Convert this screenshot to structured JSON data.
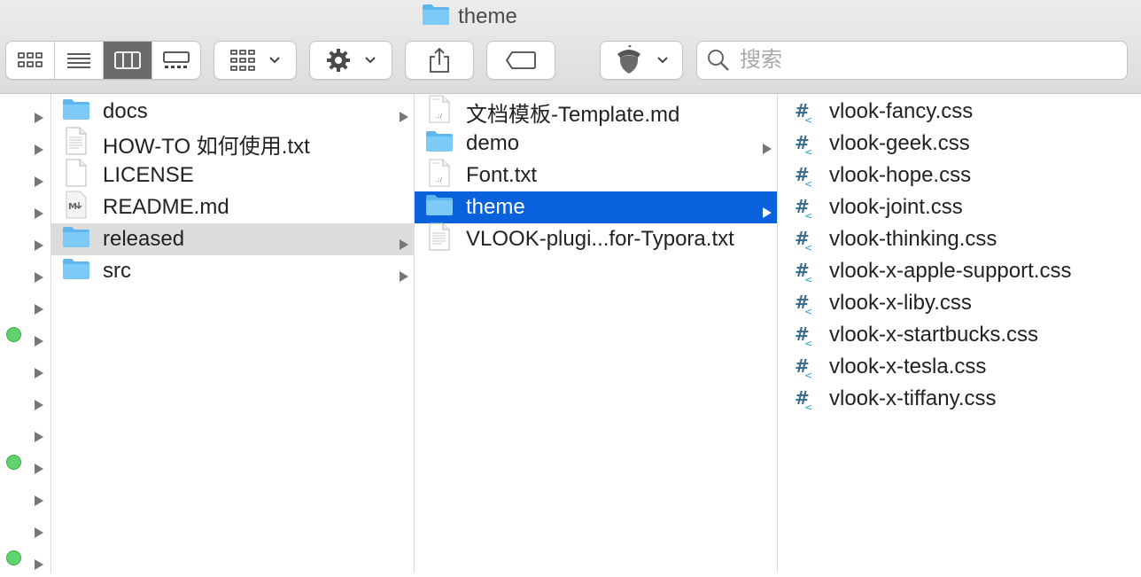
{
  "window": {
    "title": "theme",
    "title_icon": "folder-icon"
  },
  "toolbar": {
    "view_modes": [
      "icon-view-icon",
      "list-view-icon",
      "column-view-icon",
      "gallery-view-icon"
    ],
    "active_view": "column-view-icon",
    "group_icon": "group-by-icon",
    "action_icon": "gear-icon",
    "share_icon": "share-icon",
    "tag_icon": "tag-icon",
    "app_icon": "acorn-icon",
    "search_placeholder": "搜索"
  },
  "column0": {
    "rows": [
      {
        "tag": false
      },
      {
        "tag": false
      },
      {
        "tag": false
      },
      {
        "tag": false
      },
      {
        "tag": false
      },
      {
        "tag": false
      },
      {
        "tag": false
      },
      {
        "tag": true
      },
      {
        "tag": false
      },
      {
        "tag": false
      },
      {
        "tag": false
      },
      {
        "tag": true
      },
      {
        "tag": false
      },
      {
        "tag": false
      },
      {
        "tag": true
      }
    ],
    "tag_color": "#5fd36e"
  },
  "column1": {
    "items": [
      {
        "label": "docs",
        "icon": "folder-icon",
        "folder": true
      },
      {
        "label": "HOW-TO 如何使用.txt",
        "icon": "text-file-icon",
        "folder": false
      },
      {
        "label": "LICENSE",
        "icon": "blank-file-icon",
        "folder": false
      },
      {
        "label": "README.md",
        "icon": "markdown-file-icon",
        "folder": false
      },
      {
        "label": "released",
        "icon": "folder-icon",
        "folder": true,
        "selected": "grey"
      },
      {
        "label": "src",
        "icon": "folder-icon",
        "folder": true
      }
    ]
  },
  "column2": {
    "items": [
      {
        "label": "文档模板-Template.md",
        "icon": "document-file-icon",
        "folder": false
      },
      {
        "label": "demo",
        "icon": "folder-icon",
        "folder": true
      },
      {
        "label": "Font.txt",
        "icon": "document-file-icon",
        "folder": false
      },
      {
        "label": "theme",
        "icon": "folder-icon",
        "folder": true,
        "selected": "blue"
      },
      {
        "label": "VLOOK-plugi...for-Typora.txt",
        "icon": "text-file-icon",
        "folder": false
      }
    ]
  },
  "column3": {
    "items": [
      {
        "label": "vlook-fancy.css",
        "icon": "css-file-icon"
      },
      {
        "label": "vlook-geek.css",
        "icon": "css-file-icon"
      },
      {
        "label": "vlook-hope.css",
        "icon": "css-file-icon"
      },
      {
        "label": "vlook-joint.css",
        "icon": "css-file-icon"
      },
      {
        "label": "vlook-thinking.css",
        "icon": "css-file-icon"
      },
      {
        "label": "vlook-x-apple-support.css",
        "icon": "css-file-icon"
      },
      {
        "label": "vlook-x-liby.css",
        "icon": "css-file-icon"
      },
      {
        "label": "vlook-x-startbucks.css",
        "icon": "css-file-icon"
      },
      {
        "label": "vlook-x-tesla.css",
        "icon": "css-file-icon"
      },
      {
        "label": "vlook-x-tiffany.css",
        "icon": "css-file-icon"
      }
    ]
  },
  "colors": {
    "selection_blue": "#0961db",
    "selection_grey": "#dcdcdc",
    "folder_blue": "#6fc2f5"
  }
}
